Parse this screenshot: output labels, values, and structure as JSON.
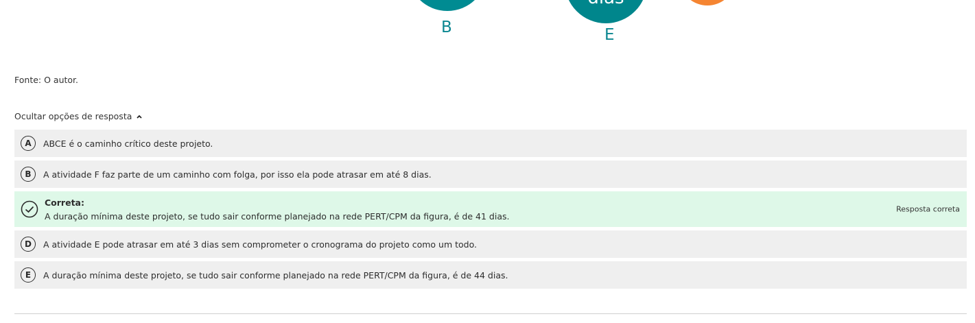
{
  "figure": {
    "node_e_text": "dias",
    "label_b": "B",
    "label_e": "E",
    "colors": {
      "teal": "#008b92",
      "orange": "#f58532"
    }
  },
  "source_text": "Fonte: O autor.",
  "toggle_label": "Ocultar opções de resposta",
  "options": [
    {
      "letter": "A",
      "text": "ABCE é o caminho crítico deste projeto."
    },
    {
      "letter": "B",
      "text": "A atividade F faz parte de um caminho com folga, por isso ela pode atrasar em até 8 dias."
    },
    {
      "status_title": "Correta:",
      "text": "A duração mínima deste projeto, se tudo sair conforme planejado na rede PERT/CPM da figura, é de 41 dias.",
      "right_label": "Resposta correta",
      "icon": "check-circle-icon"
    },
    {
      "letter": "D",
      "text": "A atividade E pode atrasar em até 3 dias sem comprometer o cronograma do projeto como um todo."
    },
    {
      "letter": "E",
      "text": "A duração mínima deste projeto, se tudo sair conforme planejado na rede PERT/CPM da figura, é de 44 dias."
    }
  ],
  "colors": {
    "option_bg": "#efefef",
    "correct_bg": "#def8e8"
  }
}
